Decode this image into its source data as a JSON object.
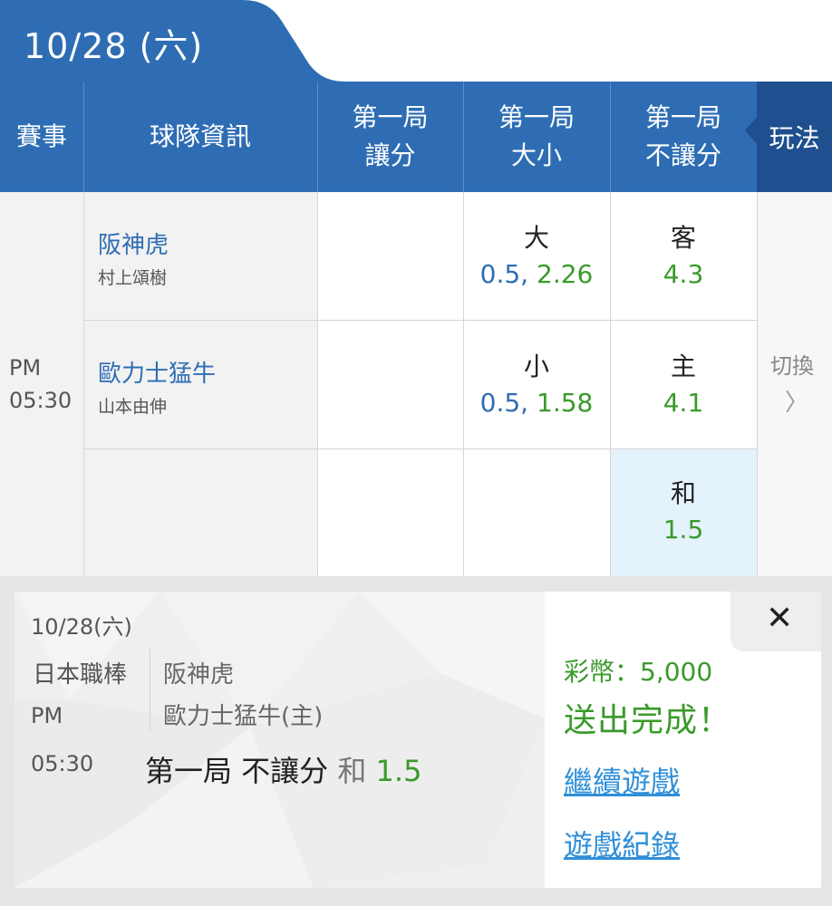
{
  "date_tab": {
    "label": "10/28 (六)"
  },
  "header": {
    "event": "賽事",
    "team_info": "球隊資訊",
    "col1": [
      "第一局",
      "讓分"
    ],
    "col2": [
      "第一局",
      "大小"
    ],
    "col3": [
      "第一局",
      "不讓分"
    ],
    "play": "玩法"
  },
  "match": {
    "time_ampm": "PM",
    "time": "05:30",
    "away_team": "阪神虎",
    "away_pitcher": "村上頌樹",
    "home_team": "歐力士猛牛",
    "home_pitcher": "山本由伸",
    "over_label": "大",
    "over_line": "0.5,",
    "over_odds": "2.26",
    "under_label": "小",
    "under_line": "0.5,",
    "under_odds": "1.58",
    "ml_away_label": "客",
    "ml_away_odds": "4.3",
    "ml_home_label": "主",
    "ml_home_odds": "4.1",
    "ml_draw_label": "和",
    "ml_draw_odds": "1.5",
    "switch_label": "切換",
    "switch_chevron": "〉"
  },
  "colors": {
    "header_blue": "#2e6db4",
    "play_dark": "#1f4f8e",
    "green": "#3a9a2b",
    "link_blue": "#2f8fd8",
    "selected_bg": "#e3f2fb"
  },
  "confirm": {
    "date": "10/28(六)",
    "league": "日本職棒",
    "ampm": "PM",
    "time": "05:30",
    "team1": "阪神虎",
    "team2": "歐力士猛牛(主)",
    "bet_market": "第一局 不讓分",
    "bet_option": "和",
    "bet_odds": "1.5",
    "coins": "彩幣：5,000",
    "status": "送出完成！",
    "continue_link": "繼續遊戲",
    "history_link": "遊戲紀錄",
    "close_symbol": "✕"
  }
}
